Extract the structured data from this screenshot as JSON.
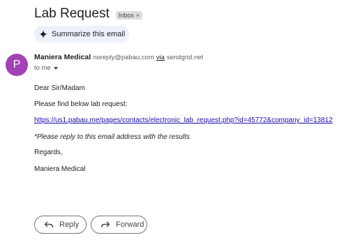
{
  "email": {
    "subject": "Lab Request",
    "label": "Inbox",
    "label_close": "×"
  },
  "summarize": {
    "label": "Summarize this email"
  },
  "sender": {
    "avatar_letter": "P",
    "name": "Maniera Medical",
    "email": "noreply@pabau.com",
    "via_label": "via",
    "via_domain": "sendgrid.net",
    "to": "to me"
  },
  "body": {
    "greeting": "Dear Sir/Madam",
    "intro": "Please find below lab request:",
    "link": "https://us1.pabau.me/pages/contacts/electronic_lab_request.php?id=45772&company_id=13812",
    "note": "*Please reply to this email address with the results",
    "regards": "Regards,",
    "signature": "Maniera Medical"
  },
  "actions": {
    "reply": "Reply",
    "forward": "Forward"
  },
  "colors": {
    "avatar": "#a142b5",
    "link": "#1a0dab",
    "summarize_bg": "#edf2fa"
  },
  "icons": [
    "sparkle-icon",
    "close-icon",
    "caret-down-icon",
    "reply-icon",
    "forward-icon"
  ]
}
